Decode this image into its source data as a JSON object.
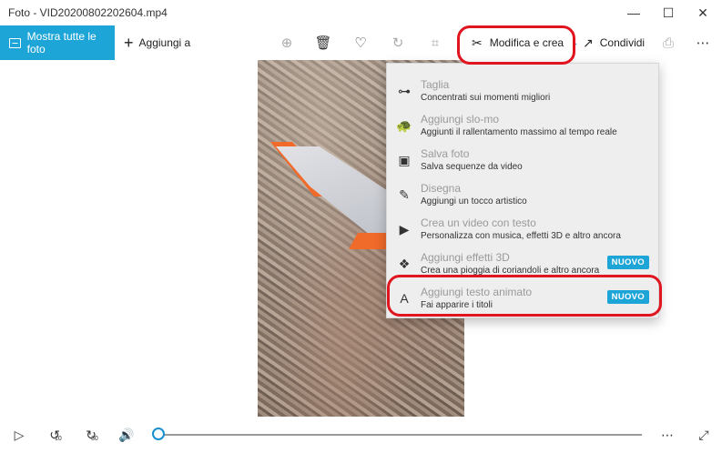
{
  "window": {
    "title": "Foto - VID20200802202604.mp4",
    "minimize_glyph": "—",
    "maximize_glyph": "☐",
    "close_glyph": "✕"
  },
  "toolbar": {
    "show_all_label": "Mostra tutte le foto",
    "add_to_label": "Aggiungi a",
    "add_to_glyph": "+",
    "edit_create_label": "Modifica e crea",
    "edit_create_glyph": "✂",
    "chevron_glyph": "⌄",
    "share_label": "Condividi",
    "share_glyph": "↗",
    "zoom_glyph": "⊕",
    "delete_glyph": "🗑",
    "favorite_glyph": "♡",
    "rotate_glyph": "↻",
    "crop_glyph": "⌗",
    "print_glyph": "⎙",
    "more_glyph": "⋯"
  },
  "menu": {
    "items": [
      {
        "title": "Taglia",
        "subtitle": "Concentrati sui momenti migliori",
        "icon": "trim-icon",
        "glyph": "⊶"
      },
      {
        "title": "Aggiungi slo-mo",
        "subtitle": "Aggiunti il rallentamento massimo al tempo reale",
        "icon": "slowmo-icon",
        "glyph": "🐢"
      },
      {
        "title": "Salva foto",
        "subtitle": "Salva sequenze da video",
        "icon": "save-photo-icon",
        "glyph": "▣"
      },
      {
        "title": "Disegna",
        "subtitle": "Aggiungi un tocco artistico",
        "icon": "draw-icon",
        "glyph": "✎"
      },
      {
        "title": "Crea un video con testo",
        "subtitle": "Personalizza con musica, effetti 3D e altro ancora",
        "icon": "video-text-icon",
        "glyph": "▶"
      },
      {
        "title": "Aggiungi effetti 3D",
        "subtitle": "Crea una pioggia di coriandoli e altro ancora",
        "icon": "effects-3d-icon",
        "glyph": "❖",
        "badge": "NUOVO"
      },
      {
        "title": "Aggiungi testo animato",
        "subtitle": "Fai apparire i titoli",
        "icon": "animated-text-icon",
        "glyph": "A",
        "badge": "NUOVO"
      }
    ]
  },
  "player": {
    "play_glyph": "▷",
    "back10_glyph": "↺",
    "back10_label": "10",
    "fwd30_glyph": "↻",
    "fwd30_label": "30",
    "volume_glyph": "🔊",
    "more_glyph": "⋯",
    "fullscreen_glyph": "⤢",
    "progress": 0.0
  },
  "colors": {
    "accent": "#1ea5d8",
    "highlight": "#e0151f",
    "wing_orange": "#f06a2a"
  }
}
